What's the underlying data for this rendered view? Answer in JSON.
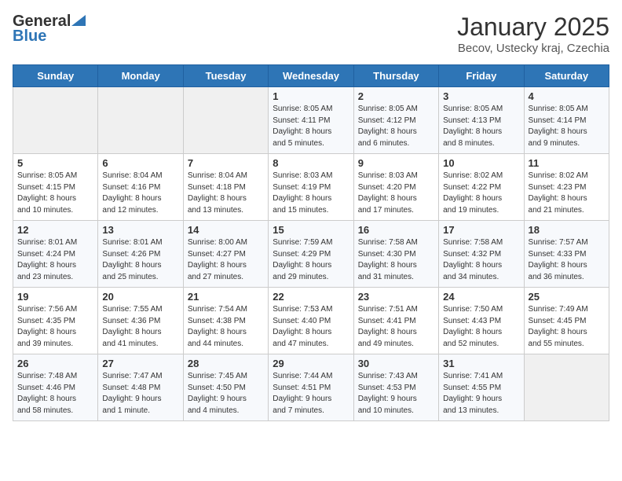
{
  "header": {
    "logo_general": "General",
    "logo_blue": "Blue",
    "month_title": "January 2025",
    "subtitle": "Becov, Ustecky kraj, Czechia"
  },
  "days_of_week": [
    "Sunday",
    "Monday",
    "Tuesday",
    "Wednesday",
    "Thursday",
    "Friday",
    "Saturday"
  ],
  "weeks": [
    [
      {
        "day": "",
        "info": ""
      },
      {
        "day": "",
        "info": ""
      },
      {
        "day": "",
        "info": ""
      },
      {
        "day": "1",
        "info": "Sunrise: 8:05 AM\nSunset: 4:11 PM\nDaylight: 8 hours\nand 5 minutes."
      },
      {
        "day": "2",
        "info": "Sunrise: 8:05 AM\nSunset: 4:12 PM\nDaylight: 8 hours\nand 6 minutes."
      },
      {
        "day": "3",
        "info": "Sunrise: 8:05 AM\nSunset: 4:13 PM\nDaylight: 8 hours\nand 8 minutes."
      },
      {
        "day": "4",
        "info": "Sunrise: 8:05 AM\nSunset: 4:14 PM\nDaylight: 8 hours\nand 9 minutes."
      }
    ],
    [
      {
        "day": "5",
        "info": "Sunrise: 8:05 AM\nSunset: 4:15 PM\nDaylight: 8 hours\nand 10 minutes."
      },
      {
        "day": "6",
        "info": "Sunrise: 8:04 AM\nSunset: 4:16 PM\nDaylight: 8 hours\nand 12 minutes."
      },
      {
        "day": "7",
        "info": "Sunrise: 8:04 AM\nSunset: 4:18 PM\nDaylight: 8 hours\nand 13 minutes."
      },
      {
        "day": "8",
        "info": "Sunrise: 8:03 AM\nSunset: 4:19 PM\nDaylight: 8 hours\nand 15 minutes."
      },
      {
        "day": "9",
        "info": "Sunrise: 8:03 AM\nSunset: 4:20 PM\nDaylight: 8 hours\nand 17 minutes."
      },
      {
        "day": "10",
        "info": "Sunrise: 8:02 AM\nSunset: 4:22 PM\nDaylight: 8 hours\nand 19 minutes."
      },
      {
        "day": "11",
        "info": "Sunrise: 8:02 AM\nSunset: 4:23 PM\nDaylight: 8 hours\nand 21 minutes."
      }
    ],
    [
      {
        "day": "12",
        "info": "Sunrise: 8:01 AM\nSunset: 4:24 PM\nDaylight: 8 hours\nand 23 minutes."
      },
      {
        "day": "13",
        "info": "Sunrise: 8:01 AM\nSunset: 4:26 PM\nDaylight: 8 hours\nand 25 minutes."
      },
      {
        "day": "14",
        "info": "Sunrise: 8:00 AM\nSunset: 4:27 PM\nDaylight: 8 hours\nand 27 minutes."
      },
      {
        "day": "15",
        "info": "Sunrise: 7:59 AM\nSunset: 4:29 PM\nDaylight: 8 hours\nand 29 minutes."
      },
      {
        "day": "16",
        "info": "Sunrise: 7:58 AM\nSunset: 4:30 PM\nDaylight: 8 hours\nand 31 minutes."
      },
      {
        "day": "17",
        "info": "Sunrise: 7:58 AM\nSunset: 4:32 PM\nDaylight: 8 hours\nand 34 minutes."
      },
      {
        "day": "18",
        "info": "Sunrise: 7:57 AM\nSunset: 4:33 PM\nDaylight: 8 hours\nand 36 minutes."
      }
    ],
    [
      {
        "day": "19",
        "info": "Sunrise: 7:56 AM\nSunset: 4:35 PM\nDaylight: 8 hours\nand 39 minutes."
      },
      {
        "day": "20",
        "info": "Sunrise: 7:55 AM\nSunset: 4:36 PM\nDaylight: 8 hours\nand 41 minutes."
      },
      {
        "day": "21",
        "info": "Sunrise: 7:54 AM\nSunset: 4:38 PM\nDaylight: 8 hours\nand 44 minutes."
      },
      {
        "day": "22",
        "info": "Sunrise: 7:53 AM\nSunset: 4:40 PM\nDaylight: 8 hours\nand 47 minutes."
      },
      {
        "day": "23",
        "info": "Sunrise: 7:51 AM\nSunset: 4:41 PM\nDaylight: 8 hours\nand 49 minutes."
      },
      {
        "day": "24",
        "info": "Sunrise: 7:50 AM\nSunset: 4:43 PM\nDaylight: 8 hours\nand 52 minutes."
      },
      {
        "day": "25",
        "info": "Sunrise: 7:49 AM\nSunset: 4:45 PM\nDaylight: 8 hours\nand 55 minutes."
      }
    ],
    [
      {
        "day": "26",
        "info": "Sunrise: 7:48 AM\nSunset: 4:46 PM\nDaylight: 8 hours\nand 58 minutes."
      },
      {
        "day": "27",
        "info": "Sunrise: 7:47 AM\nSunset: 4:48 PM\nDaylight: 9 hours\nand 1 minute."
      },
      {
        "day": "28",
        "info": "Sunrise: 7:45 AM\nSunset: 4:50 PM\nDaylight: 9 hours\nand 4 minutes."
      },
      {
        "day": "29",
        "info": "Sunrise: 7:44 AM\nSunset: 4:51 PM\nDaylight: 9 hours\nand 7 minutes."
      },
      {
        "day": "30",
        "info": "Sunrise: 7:43 AM\nSunset: 4:53 PM\nDaylight: 9 hours\nand 10 minutes."
      },
      {
        "day": "31",
        "info": "Sunrise: 7:41 AM\nSunset: 4:55 PM\nDaylight: 9 hours\nand 13 minutes."
      },
      {
        "day": "",
        "info": ""
      }
    ]
  ]
}
